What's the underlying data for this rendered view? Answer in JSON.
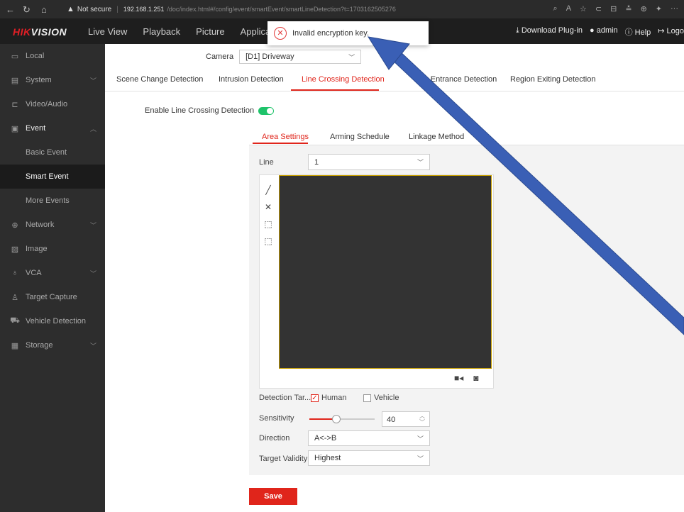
{
  "browser": {
    "security_label": "Not secure",
    "url_host": "192.168.1.251",
    "url_path": "/doc/index.html#/config/event/smartEvent/smartLineDetection?t=1703162505276"
  },
  "header": {
    "logo_hik": "HIK",
    "logo_vision": "VISION",
    "nav": [
      "Live View",
      "Playback",
      "Picture",
      "Applica"
    ],
    "download": "Download Plug-in",
    "user": "admin",
    "help": "Help",
    "logout": "Logo"
  },
  "toast": {
    "message": "Invalid encryption key."
  },
  "sidebar": {
    "items": [
      {
        "label": "Local"
      },
      {
        "label": "System"
      },
      {
        "label": "Video/Audio"
      },
      {
        "label": "Event"
      },
      {
        "label": "Basic Event"
      },
      {
        "label": "Smart Event"
      },
      {
        "label": "More Events"
      },
      {
        "label": "Network"
      },
      {
        "label": "Image"
      },
      {
        "label": "VCA"
      },
      {
        "label": "Target Capture"
      },
      {
        "label": "Vehicle Detection"
      },
      {
        "label": "Storage"
      }
    ]
  },
  "main": {
    "camera_label": "Camera",
    "camera_value": "[D1] Driveway",
    "tabs": [
      {
        "label": "Scene Change Detection"
      },
      {
        "label": "Intrusion Detection"
      },
      {
        "label": "Line Crossing Detection"
      },
      {
        "label": "ion Entrance Detection"
      },
      {
        "label": "Region Exiting Detection"
      }
    ],
    "enable_label": "Enable Line Crossing Detection",
    "subtabs": [
      {
        "label": "Area Settings"
      },
      {
        "label": "Arming Schedule"
      },
      {
        "label": "Linkage Method"
      }
    ],
    "line_label": "Line",
    "line_value": "1",
    "detection_target_label": "Detection Tar...",
    "human_label": "Human",
    "vehicle_label": "Vehicle",
    "sensitivity_label": "Sensitivity",
    "sensitivity_value": "40",
    "direction_label": "Direction",
    "direction_value": "A<->B",
    "target_validity_label": "Target Validity",
    "target_validity_value": "Highest",
    "save_label": "Save"
  },
  "colors": {
    "accent": "#e0251b",
    "toggle_on": "#1ec36a",
    "annotation_arrow": "#3a5fb5"
  }
}
